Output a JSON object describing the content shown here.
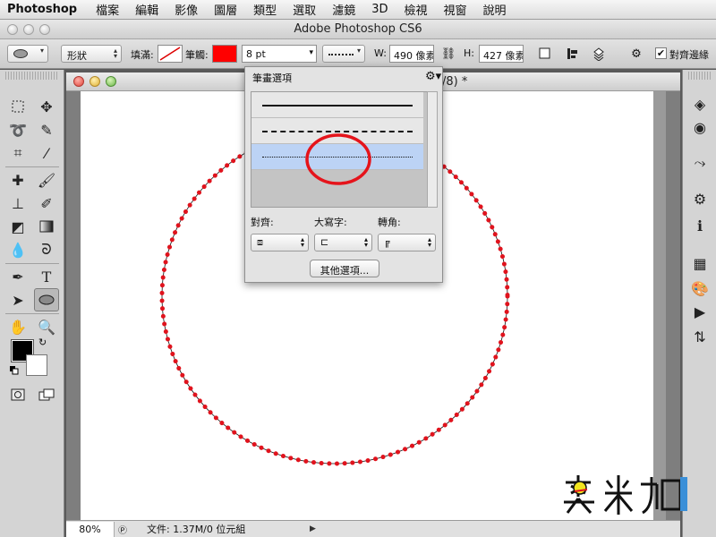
{
  "menubar": {
    "app": "Photoshop",
    "items": [
      "檔案",
      "編輯",
      "影像",
      "圖層",
      "類型",
      "選取",
      "濾鏡",
      "3D",
      "檢視",
      "視窗",
      "說明"
    ]
  },
  "window": {
    "title": "Adobe Photoshop CS6"
  },
  "options": {
    "mode_value": "形狀",
    "fill_label": "填滿:",
    "stroke_label": "筆觸:",
    "stroke_color": "#ff0000",
    "stroke_width": "8 pt",
    "w_label": "W:",
    "w_value": "490 像素",
    "h_label": "H:",
    "h_value": "427 像素",
    "align_edges_label": "對齊邊緣",
    "align_edges_checked": true
  },
  "document": {
    "title_suffix": "/8) *",
    "zoom": "80%",
    "file_info": "文件: 1.37M/0 位元組",
    "canvas_bg": "#ffffff",
    "ellipse_stroke": "#e0131d"
  },
  "stroke_popup": {
    "title": "筆畫選項",
    "styles": [
      "solid",
      "dashed",
      "dotted"
    ],
    "selected_style": "dotted",
    "align_label": "對齊:",
    "caps_label": "大寫字:",
    "corners_label": "轉角:",
    "more_button": "其他選項...",
    "highlight_color": "#e5141b"
  },
  "watermark": {
    "text": "奧米加"
  }
}
